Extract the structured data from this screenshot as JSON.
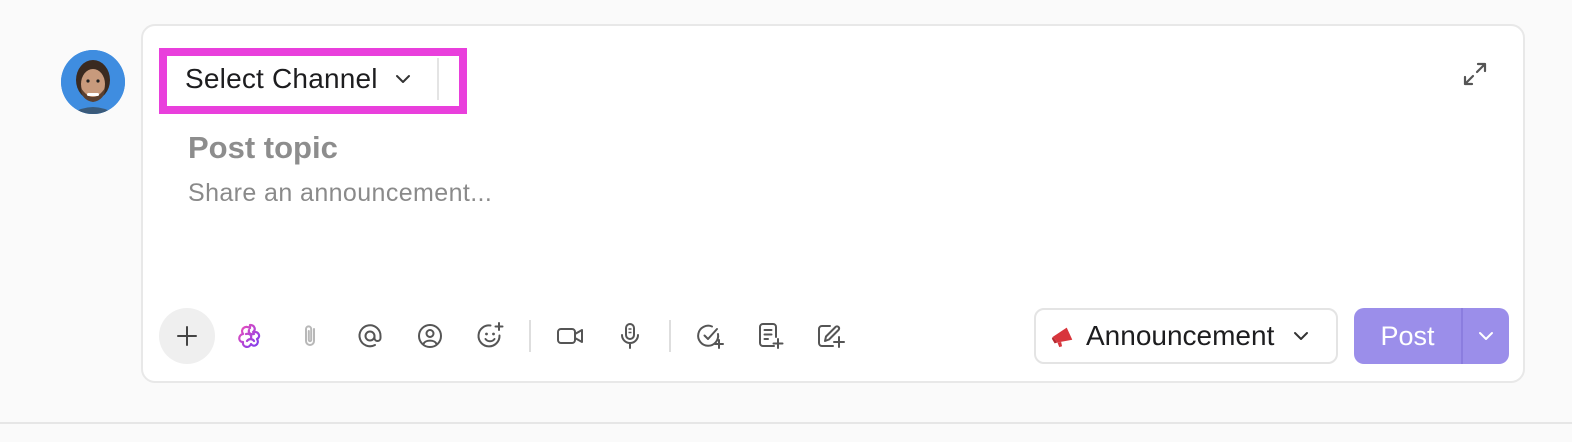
{
  "composer": {
    "channel_select": {
      "label": "Select Channel"
    },
    "topic_placeholder": "Post topic",
    "body_placeholder": "Share an announcement...",
    "post_type": {
      "label": "Announcement",
      "icon": "megaphone-icon",
      "icon_color": "#d8353c"
    },
    "post_button": {
      "label": "Post",
      "color": "#9b8eea"
    }
  },
  "toolbar": {
    "icons": [
      "plus-icon",
      "ai-brain-icon",
      "paperclip-icon",
      "mention-icon",
      "contact-icon",
      "emoji-add-icon",
      "video-icon",
      "microphone-icon",
      "task-add-icon",
      "doc-add-icon",
      "whiteboard-add-icon"
    ]
  },
  "colors": {
    "highlight": "#e93fdc",
    "avatar_bg": "#3f8de0"
  }
}
